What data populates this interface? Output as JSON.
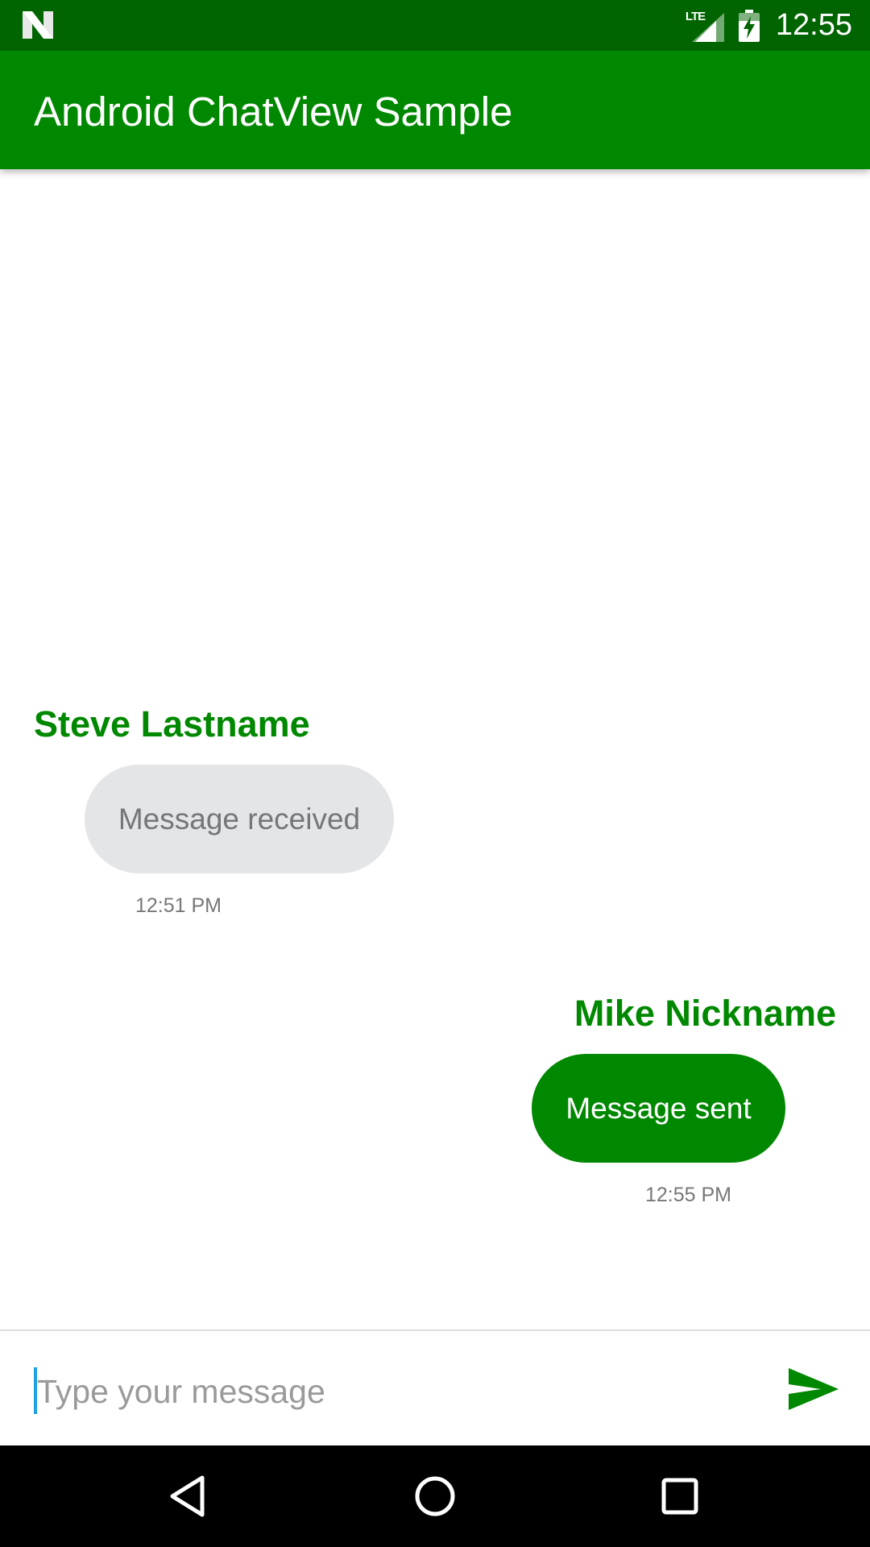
{
  "status_bar": {
    "network": "LTE",
    "time": "12:55",
    "icons": [
      "n-logo-icon",
      "signal-icon",
      "battery-icon"
    ]
  },
  "app_bar": {
    "title": "Android ChatView Sample"
  },
  "messages": [
    {
      "sender": "Steve Lastname",
      "text": "Message received",
      "time": "12:51 PM",
      "direction": "received"
    },
    {
      "sender": "Mike Nickname",
      "text": "Message sent",
      "time": "12:55 PM",
      "direction": "sent"
    }
  ],
  "composer": {
    "placeholder": "Type your message",
    "value": "",
    "send_icon": "send-icon"
  },
  "nav_bar": {
    "icons": [
      "back-icon",
      "home-icon",
      "recents-icon"
    ]
  },
  "colors": {
    "status_bar": "#006400",
    "accent": "#008800",
    "received_bubble": "#e4e5e7",
    "received_text": "#72777a",
    "sent_text": "#ffffff",
    "timestamp": "#777777",
    "cursor": "#1da1e0"
  }
}
